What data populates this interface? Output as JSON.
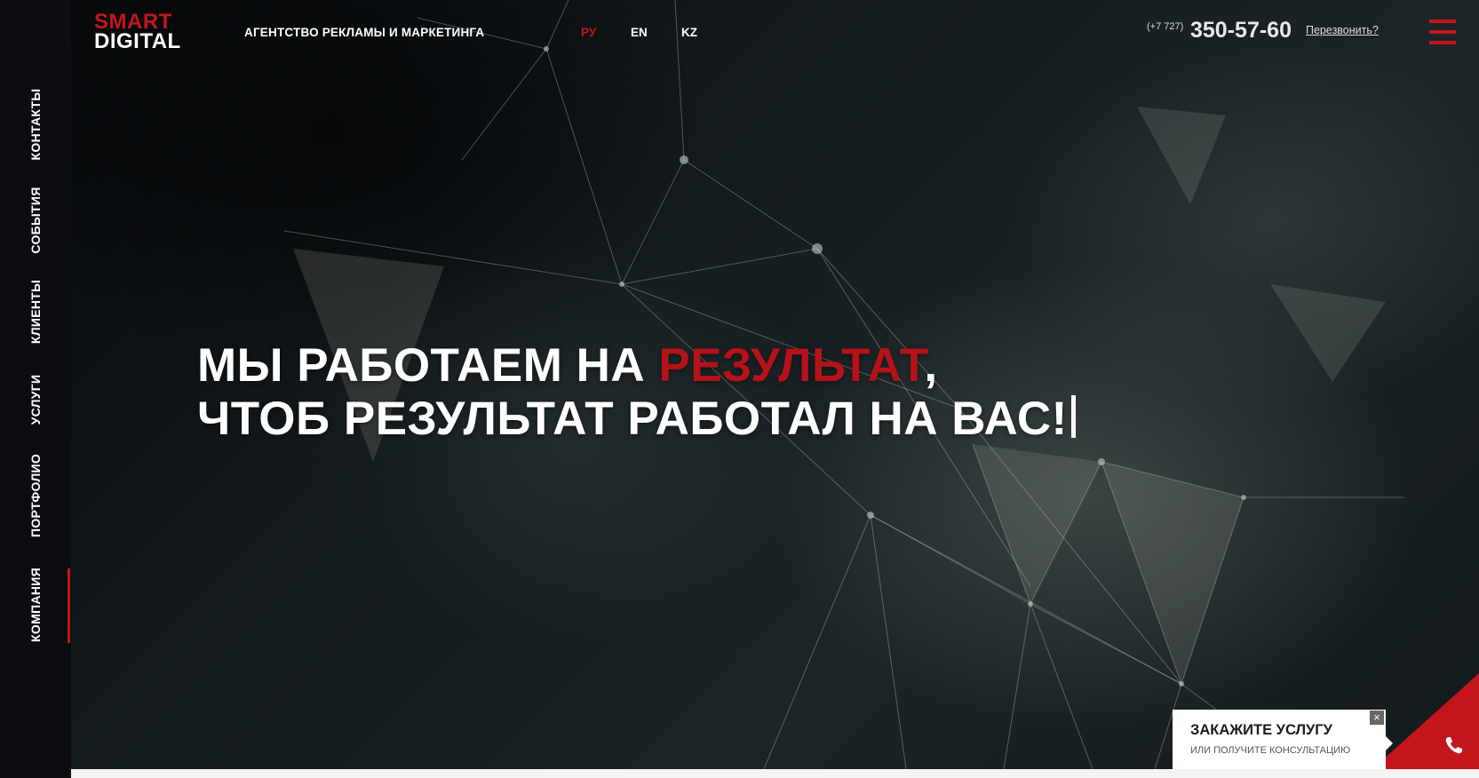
{
  "logo": {
    "line1": "SMART",
    "line2": "DIGITAL"
  },
  "header": {
    "tagline": "АГЕНТСТВО РЕКЛАМЫ И МАРКЕТИНГА",
    "languages": [
      {
        "label": "РУ",
        "active": true
      },
      {
        "label": "EN",
        "active": false
      },
      {
        "label": "KZ",
        "active": false
      }
    ],
    "phone_prefix": "(+7 727)",
    "phone_number": "350-57-60",
    "callback_label": "Перезвонить?",
    "menu_icon": "hamburger-icon"
  },
  "side_nav": {
    "items": [
      {
        "label": "КОНТАКТЫ",
        "active": false
      },
      {
        "label": "СОБЫТИЯ",
        "active": false
      },
      {
        "label": "КЛИЕНТЫ",
        "active": false
      },
      {
        "label": "УСЛУГИ",
        "active": false
      },
      {
        "label": "ПОРТФОЛИО",
        "active": false
      },
      {
        "label": "КОМПАНИЯ",
        "active": true
      }
    ]
  },
  "hero": {
    "line1_part1": "МЫ РАБОТАЕМ НА ",
    "line1_accent": "РЕЗУЛЬТАТ",
    "line1_part2": ",",
    "line2": "ЧТОБ РЕЗУЛЬТАТ РАБОТАЛ НА ВАС!"
  },
  "order_widget": {
    "title": "ЗАКАЖИТЕ УСЛУГУ",
    "subtitle": "ИЛИ ПОЛУЧИТЕ КОНСУЛЬТАЦИЮ",
    "close_icon": "close-icon",
    "call_icon": "phone-icon"
  },
  "colors": {
    "accent": "#c3161c",
    "background": "#101418",
    "sidebar": "#0b0d10"
  }
}
